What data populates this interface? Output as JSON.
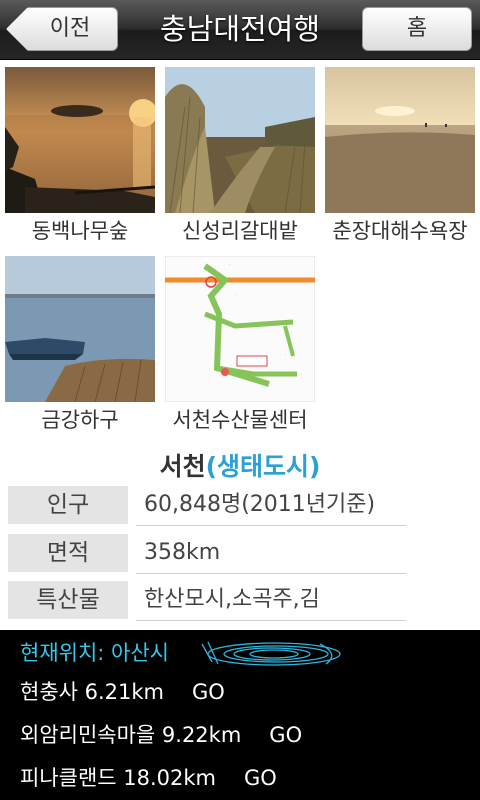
{
  "header": {
    "title": "충남대전여행",
    "back_label": "이전",
    "home_label": "홈"
  },
  "gallery": [
    {
      "caption": "동백나무숲"
    },
    {
      "caption": "신성리갈대밭"
    },
    {
      "caption": "춘장대해수욕장"
    },
    {
      "caption": "금강하구"
    },
    {
      "caption": "서천수산물센터"
    }
  ],
  "info": {
    "name": "서천",
    "subtitle": "(생태도시)",
    "subtitle_color": "#2aa0d6",
    "rows": [
      {
        "label": "인구",
        "value": "60,848명(2011년기준)"
      },
      {
        "label": "면적",
        "value": "358km"
      },
      {
        "label": "특산물",
        "value": "한산모시,소곡주,김"
      }
    ]
  },
  "nearby": {
    "location": "현재위치: 아산시",
    "places": [
      {
        "name": "현충사 6.21km",
        "go": "GO"
      },
      {
        "name": "외암리민속마을 9.22km",
        "go": "GO"
      },
      {
        "name": "피나클랜드 18.02km",
        "go": "GO"
      }
    ]
  }
}
